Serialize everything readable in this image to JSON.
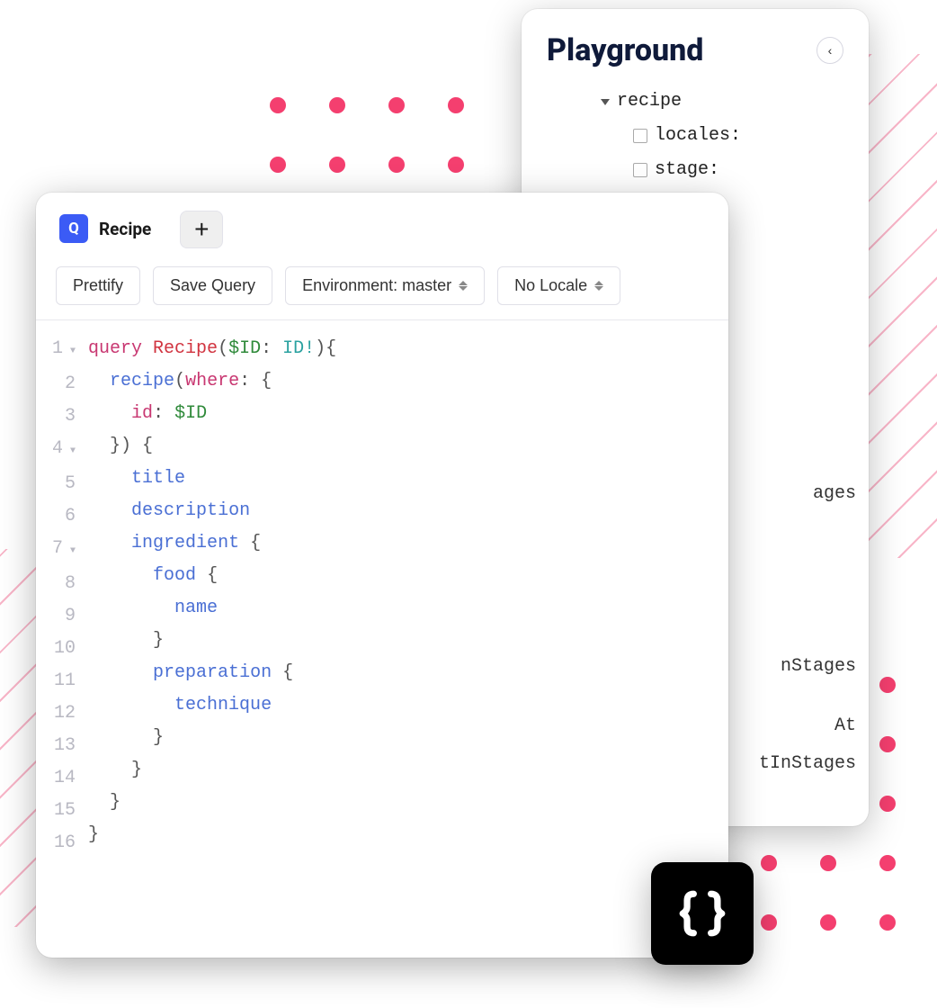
{
  "playground": {
    "title": "Playground",
    "tree": {
      "root": "recipe",
      "children": [
        {
          "label": "locales:"
        },
        {
          "label": "stage:"
        }
      ]
    },
    "peek_fragments": [
      "ages",
      "nStages",
      "At",
      "tInStages"
    ]
  },
  "editor": {
    "tab": {
      "badge": "Q",
      "label": "Recipe"
    },
    "toolbar": {
      "prettify": "Prettify",
      "save": "Save Query",
      "environment": "Environment: master",
      "locale": "No Locale"
    },
    "code": {
      "lines": [
        {
          "n": 1,
          "fold": true,
          "tokens": [
            [
              "kw",
              "query "
            ],
            [
              "name",
              "Recipe"
            ],
            [
              "punc",
              "("
            ],
            [
              "var",
              "$ID"
            ],
            [
              "punc",
              ": "
            ],
            [
              "type",
              "ID!"
            ],
            [
              "punc",
              "){"
            ]
          ]
        },
        {
          "n": 2,
          "fold": false,
          "tokens": [
            [
              "punc",
              "  "
            ],
            [
              "fld",
              "recipe"
            ],
            [
              "punc",
              "("
            ],
            [
              "arg",
              "where"
            ],
            [
              "punc",
              ": {"
            ]
          ]
        },
        {
          "n": 3,
          "fold": false,
          "tokens": [
            [
              "punc",
              "    "
            ],
            [
              "arg",
              "id"
            ],
            [
              "punc",
              ": "
            ],
            [
              "var",
              "$ID"
            ]
          ]
        },
        {
          "n": 4,
          "fold": true,
          "tokens": [
            [
              "punc",
              "  }) {"
            ]
          ]
        },
        {
          "n": 5,
          "fold": false,
          "tokens": [
            [
              "punc",
              "    "
            ],
            [
              "fld",
              "title"
            ]
          ]
        },
        {
          "n": 6,
          "fold": false,
          "tokens": [
            [
              "punc",
              "    "
            ],
            [
              "fld",
              "description"
            ]
          ]
        },
        {
          "n": 7,
          "fold": true,
          "tokens": [
            [
              "punc",
              "    "
            ],
            [
              "fld",
              "ingredient"
            ],
            [
              "punc",
              " {"
            ]
          ]
        },
        {
          "n": 8,
          "fold": false,
          "tokens": [
            [
              "punc",
              "      "
            ],
            [
              "fld",
              "food"
            ],
            [
              "punc",
              " {"
            ]
          ]
        },
        {
          "n": 9,
          "fold": false,
          "tokens": [
            [
              "punc",
              "        "
            ],
            [
              "fld",
              "name"
            ]
          ]
        },
        {
          "n": 10,
          "fold": false,
          "tokens": [
            [
              "punc",
              "      }"
            ]
          ]
        },
        {
          "n": 11,
          "fold": false,
          "tokens": [
            [
              "punc",
              "      "
            ],
            [
              "fld",
              "preparation"
            ],
            [
              "punc",
              " {"
            ]
          ]
        },
        {
          "n": 12,
          "fold": false,
          "tokens": [
            [
              "punc",
              "        "
            ],
            [
              "fld",
              "technique"
            ]
          ]
        },
        {
          "n": 13,
          "fold": false,
          "tokens": [
            [
              "punc",
              "      }"
            ]
          ]
        },
        {
          "n": 14,
          "fold": false,
          "tokens": [
            [
              "punc",
              "    }"
            ]
          ]
        },
        {
          "n": 15,
          "fold": false,
          "tokens": [
            [
              "punc",
              "  }"
            ]
          ]
        },
        {
          "n": 16,
          "fold": false,
          "tokens": [
            [
              "punc",
              "}"
            ]
          ]
        }
      ]
    }
  }
}
